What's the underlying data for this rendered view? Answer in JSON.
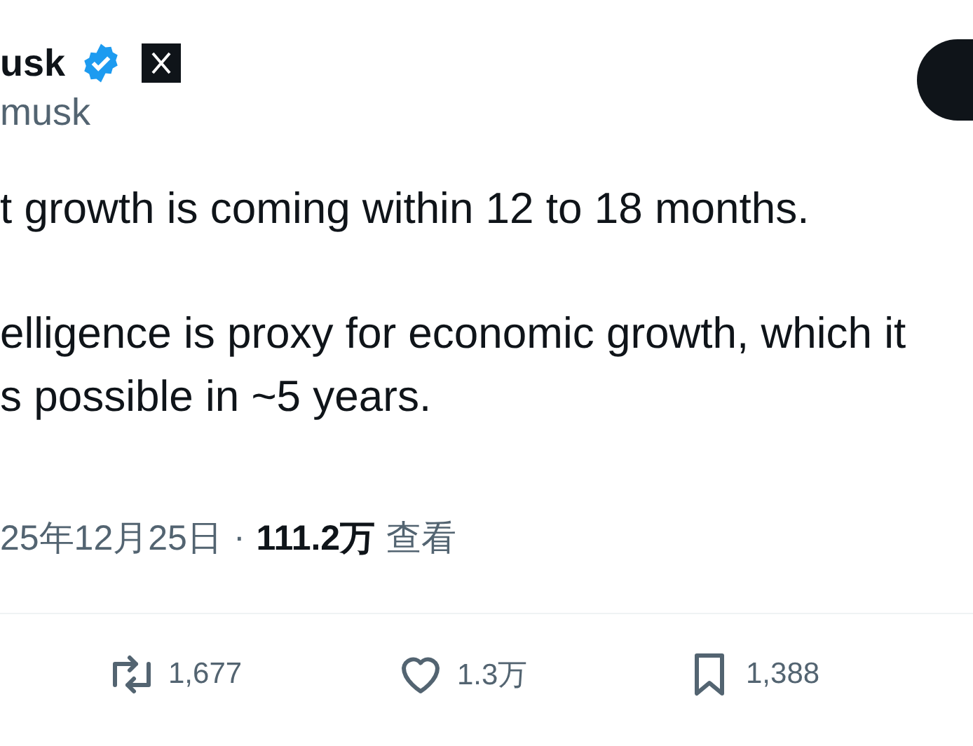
{
  "author": {
    "name": "usk",
    "verified": true,
    "handle": "musk"
  },
  "post": {
    "paragraphs": [
      "t growth is coming within 12 to 18 months.",
      "elligence is proxy for economic growth, which it\ns possible in ~5 years."
    ]
  },
  "meta": {
    "date": "25年12月25日",
    "separator": "·",
    "views": "111.2万",
    "views_label": "查看"
  },
  "actions": [
    {
      "kind": "repost",
      "count": "1,677"
    },
    {
      "kind": "like",
      "count": "1.3万"
    },
    {
      "kind": "bookmark",
      "count": "1,388"
    }
  ]
}
